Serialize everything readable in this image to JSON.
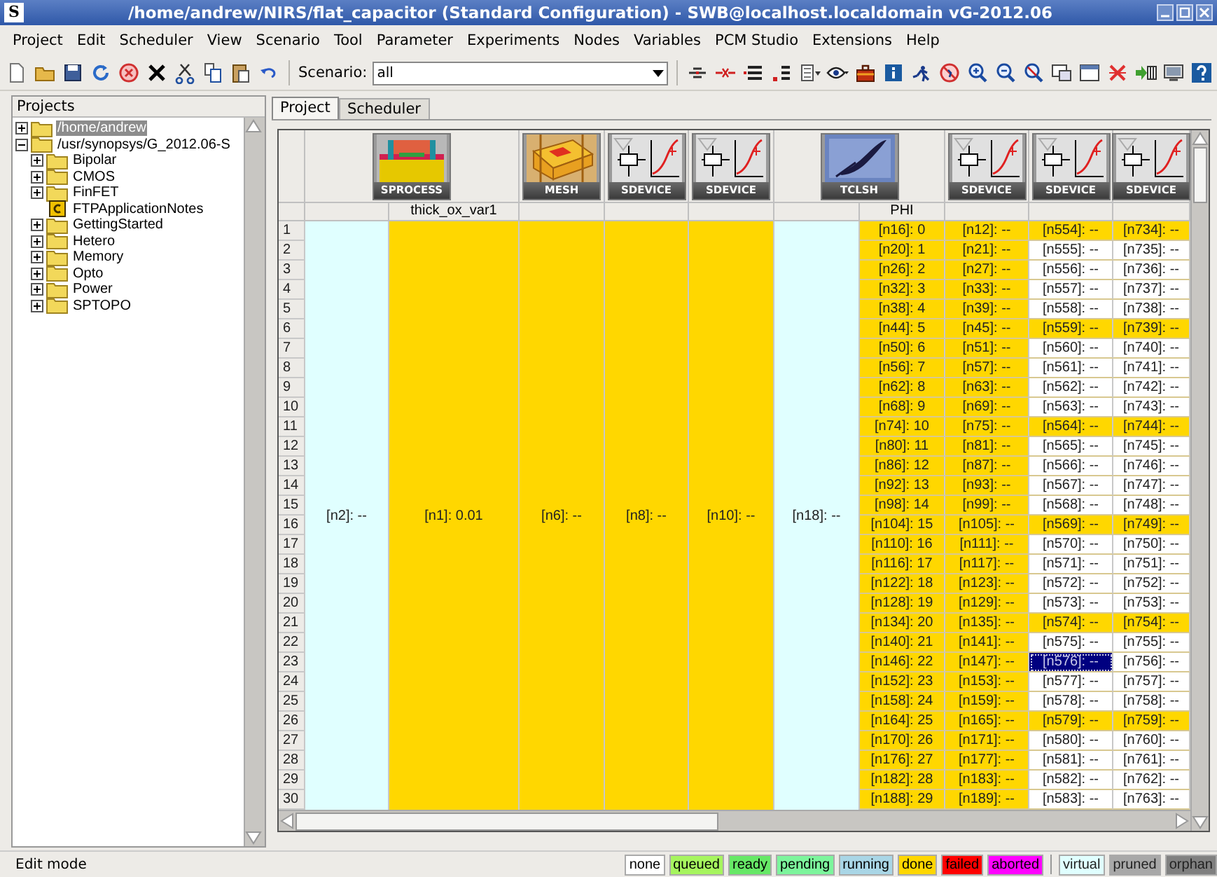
{
  "window": {
    "icon_letter": "S",
    "title": "/home/andrew/NIRS/flat_capacitor (Standard Configuration) - SWB@localhost.localdomain vG-2012.06"
  },
  "menu": [
    "Project",
    "Edit",
    "Scheduler",
    "View",
    "Scenario",
    "Tool",
    "Parameter",
    "Experiments",
    "Nodes",
    "Variables",
    "PCM Studio",
    "Extensions",
    "Help"
  ],
  "toolbar": {
    "scenario_label": "Scenario:",
    "scenario_value": "all"
  },
  "projects": {
    "title": "Projects",
    "items": [
      {
        "label": "/home/andrew",
        "kind": "folder",
        "expanded": false,
        "selected": true
      },
      {
        "label": "/usr/synopsys/G_2012.06-S",
        "kind": "folder",
        "expanded": true,
        "selected": false,
        "children": [
          {
            "label": "Bipolar",
            "kind": "folder",
            "expanded": false,
            "selected": false
          },
          {
            "label": "CMOS",
            "kind": "folder",
            "expanded": false,
            "selected": false
          },
          {
            "label": "FinFET",
            "kind": "folder",
            "expanded": false,
            "selected": false
          },
          {
            "label": "FTPApplicationNotes",
            "kind": "project",
            "selected": false
          },
          {
            "label": "GettingStarted",
            "kind": "folder",
            "expanded": false,
            "selected": false
          },
          {
            "label": "Hetero",
            "kind": "folder",
            "expanded": false,
            "selected": false
          },
          {
            "label": "Memory",
            "kind": "folder",
            "expanded": false,
            "selected": false
          },
          {
            "label": "Opto",
            "kind": "folder",
            "expanded": false,
            "selected": false
          },
          {
            "label": "Power",
            "kind": "folder",
            "expanded": false,
            "selected": false
          },
          {
            "label": "SPTOPO",
            "kind": "folder",
            "expanded": false,
            "selected": false
          }
        ]
      }
    ]
  },
  "tabs": [
    {
      "label": "Project",
      "selected": true
    },
    {
      "label": "Scheduler",
      "selected": false
    }
  ],
  "tools": [
    {
      "label": "SPROCESS",
      "kind": "sprocess",
      "parameters": [
        "thick_ox_var1"
      ]
    },
    {
      "label": "MESH",
      "kind": "mesh"
    },
    {
      "label": "SDEVICE",
      "kind": "sdevice"
    },
    {
      "label": "SDEVICE",
      "kind": "sdevice"
    },
    {
      "label": "TCLSH",
      "kind": "tclsh",
      "parameters": [
        "PHI"
      ]
    },
    {
      "label": "SDEVICE",
      "kind": "sdevice"
    },
    {
      "label": "SDEVICE",
      "kind": "sdevice"
    },
    {
      "label": "SDEVICE",
      "kind": "sdevice"
    }
  ],
  "merged_cells": [
    {
      "text": "[n2]: --",
      "color": "#e0ffff"
    },
    {
      "text": "[n1]: 0.01",
      "color": "#ffd700"
    },
    {
      "text": "[n6]: --",
      "color": "#ffd700"
    },
    {
      "text": "[n8]: --",
      "color": "#ffd700"
    },
    {
      "text": "[n10]: --",
      "color": "#ffd700"
    },
    {
      "text": "[n18]: --",
      "color": "#e0ffff"
    }
  ],
  "rows": [
    {
      "number": "1",
      "cells": [
        {
          "text": "[n16]: 0",
          "color": "#ffd700",
          "selected": false
        },
        {
          "text": "[n12]: --",
          "color": "#ffd700",
          "selected": false
        },
        {
          "text": "[n554]: --",
          "color": "#ffd700",
          "selected": false
        },
        {
          "text": "[n734]: --",
          "color": "#ffd700",
          "selected": false
        }
      ]
    },
    {
      "number": "2",
      "cells": [
        {
          "text": "[n20]: 1",
          "color": "#ffd700",
          "selected": false
        },
        {
          "text": "[n21]: --",
          "color": "#ffd700",
          "selected": false
        },
        {
          "text": "[n555]: --",
          "color": "#ffffff",
          "selected": false
        },
        {
          "text": "[n735]: --",
          "color": "#ffffff",
          "selected": false
        }
      ]
    },
    {
      "number": "3",
      "cells": [
        {
          "text": "[n26]: 2",
          "color": "#ffd700",
          "selected": false
        },
        {
          "text": "[n27]: --",
          "color": "#ffd700",
          "selected": false
        },
        {
          "text": "[n556]: --",
          "color": "#ffffff",
          "selected": false
        },
        {
          "text": "[n736]: --",
          "color": "#ffffff",
          "selected": false
        }
      ]
    },
    {
      "number": "4",
      "cells": [
        {
          "text": "[n32]: 3",
          "color": "#ffd700",
          "selected": false
        },
        {
          "text": "[n33]: --",
          "color": "#ffd700",
          "selected": false
        },
        {
          "text": "[n557]: --",
          "color": "#ffffff",
          "selected": false
        },
        {
          "text": "[n737]: --",
          "color": "#ffffff",
          "selected": false
        }
      ]
    },
    {
      "number": "5",
      "cells": [
        {
          "text": "[n38]: 4",
          "color": "#ffd700",
          "selected": false
        },
        {
          "text": "[n39]: --",
          "color": "#ffd700",
          "selected": false
        },
        {
          "text": "[n558]: --",
          "color": "#ffffff",
          "selected": false
        },
        {
          "text": "[n738]: --",
          "color": "#ffffff",
          "selected": false
        }
      ]
    },
    {
      "number": "6",
      "cells": [
        {
          "text": "[n44]: 5",
          "color": "#ffd700",
          "selected": false
        },
        {
          "text": "[n45]: --",
          "color": "#ffd700",
          "selected": false
        },
        {
          "text": "[n559]: --",
          "color": "#ffd700",
          "selected": false
        },
        {
          "text": "[n739]: --",
          "color": "#ffd700",
          "selected": false
        }
      ]
    },
    {
      "number": "7",
      "cells": [
        {
          "text": "[n50]: 6",
          "color": "#ffd700",
          "selected": false
        },
        {
          "text": "[n51]: --",
          "color": "#ffd700",
          "selected": false
        },
        {
          "text": "[n560]: --",
          "color": "#ffffff",
          "selected": false
        },
        {
          "text": "[n740]: --",
          "color": "#ffffff",
          "selected": false
        }
      ]
    },
    {
      "number": "8",
      "cells": [
        {
          "text": "[n56]: 7",
          "color": "#ffd700",
          "selected": false
        },
        {
          "text": "[n57]: --",
          "color": "#ffd700",
          "selected": false
        },
        {
          "text": "[n561]: --",
          "color": "#ffffff",
          "selected": false
        },
        {
          "text": "[n741]: --",
          "color": "#ffffff",
          "selected": false
        }
      ]
    },
    {
      "number": "9",
      "cells": [
        {
          "text": "[n62]: 8",
          "color": "#ffd700",
          "selected": false
        },
        {
          "text": "[n63]: --",
          "color": "#ffd700",
          "selected": false
        },
        {
          "text": "[n562]: --",
          "color": "#ffffff",
          "selected": false
        },
        {
          "text": "[n742]: --",
          "color": "#ffffff",
          "selected": false
        }
      ]
    },
    {
      "number": "10",
      "cells": [
        {
          "text": "[n68]: 9",
          "color": "#ffd700",
          "selected": false
        },
        {
          "text": "[n69]: --",
          "color": "#ffd700",
          "selected": false
        },
        {
          "text": "[n563]: --",
          "color": "#ffffff",
          "selected": false
        },
        {
          "text": "[n743]: --",
          "color": "#ffffff",
          "selected": false
        }
      ]
    },
    {
      "number": "11",
      "cells": [
        {
          "text": "[n74]: 10",
          "color": "#ffd700",
          "selected": false
        },
        {
          "text": "[n75]: --",
          "color": "#ffd700",
          "selected": false
        },
        {
          "text": "[n564]: --",
          "color": "#ffd700",
          "selected": false
        },
        {
          "text": "[n744]: --",
          "color": "#ffd700",
          "selected": false
        }
      ]
    },
    {
      "number": "12",
      "cells": [
        {
          "text": "[n80]: 11",
          "color": "#ffd700",
          "selected": false
        },
        {
          "text": "[n81]: --",
          "color": "#ffd700",
          "selected": false
        },
        {
          "text": "[n565]: --",
          "color": "#ffffff",
          "selected": false
        },
        {
          "text": "[n745]: --",
          "color": "#ffffff",
          "selected": false
        }
      ]
    },
    {
      "number": "13",
      "cells": [
        {
          "text": "[n86]: 12",
          "color": "#ffd700",
          "selected": false
        },
        {
          "text": "[n87]: --",
          "color": "#ffd700",
          "selected": false
        },
        {
          "text": "[n566]: --",
          "color": "#ffffff",
          "selected": false
        },
        {
          "text": "[n746]: --",
          "color": "#ffffff",
          "selected": false
        }
      ]
    },
    {
      "number": "14",
      "cells": [
        {
          "text": "[n92]: 13",
          "color": "#ffd700",
          "selected": false
        },
        {
          "text": "[n93]: --",
          "color": "#ffd700",
          "selected": false
        },
        {
          "text": "[n567]: --",
          "color": "#ffffff",
          "selected": false
        },
        {
          "text": "[n747]: --",
          "color": "#ffffff",
          "selected": false
        }
      ]
    },
    {
      "number": "15",
      "cells": [
        {
          "text": "[n98]: 14",
          "color": "#ffd700",
          "selected": false
        },
        {
          "text": "[n99]: --",
          "color": "#ffd700",
          "selected": false
        },
        {
          "text": "[n568]: --",
          "color": "#ffffff",
          "selected": false
        },
        {
          "text": "[n748]: --",
          "color": "#ffffff",
          "selected": false
        }
      ]
    },
    {
      "number": "16",
      "cells": [
        {
          "text": "[n104]: 15",
          "color": "#ffd700",
          "selected": false
        },
        {
          "text": "[n105]: --",
          "color": "#ffd700",
          "selected": false
        },
        {
          "text": "[n569]: --",
          "color": "#ffd700",
          "selected": false
        },
        {
          "text": "[n749]: --",
          "color": "#ffd700",
          "selected": false
        }
      ]
    },
    {
      "number": "17",
      "cells": [
        {
          "text": "[n110]: 16",
          "color": "#ffd700",
          "selected": false
        },
        {
          "text": "[n111]: --",
          "color": "#ffd700",
          "selected": false
        },
        {
          "text": "[n570]: --",
          "color": "#ffffff",
          "selected": false
        },
        {
          "text": "[n750]: --",
          "color": "#ffffff",
          "selected": false
        }
      ]
    },
    {
      "number": "18",
      "cells": [
        {
          "text": "[n116]: 17",
          "color": "#ffd700",
          "selected": false
        },
        {
          "text": "[n117]: --",
          "color": "#ffd700",
          "selected": false
        },
        {
          "text": "[n571]: --",
          "color": "#ffffff",
          "selected": false
        },
        {
          "text": "[n751]: --",
          "color": "#ffffff",
          "selected": false
        }
      ]
    },
    {
      "number": "19",
      "cells": [
        {
          "text": "[n122]: 18",
          "color": "#ffd700",
          "selected": false
        },
        {
          "text": "[n123]: --",
          "color": "#ffd700",
          "selected": false
        },
        {
          "text": "[n572]: --",
          "color": "#ffffff",
          "selected": false
        },
        {
          "text": "[n752]: --",
          "color": "#ffffff",
          "selected": false
        }
      ]
    },
    {
      "number": "20",
      "cells": [
        {
          "text": "[n128]: 19",
          "color": "#ffd700",
          "selected": false
        },
        {
          "text": "[n129]: --",
          "color": "#ffd700",
          "selected": false
        },
        {
          "text": "[n573]: --",
          "color": "#ffffff",
          "selected": false
        },
        {
          "text": "[n753]: --",
          "color": "#ffffff",
          "selected": false
        }
      ]
    },
    {
      "number": "21",
      "cells": [
        {
          "text": "[n134]: 20",
          "color": "#ffd700",
          "selected": false
        },
        {
          "text": "[n135]: --",
          "color": "#ffd700",
          "selected": false
        },
        {
          "text": "[n574]: --",
          "color": "#ffd700",
          "selected": false
        },
        {
          "text": "[n754]: --",
          "color": "#ffd700",
          "selected": false
        }
      ]
    },
    {
      "number": "22",
      "cells": [
        {
          "text": "[n140]: 21",
          "color": "#ffd700",
          "selected": false
        },
        {
          "text": "[n141]: --",
          "color": "#ffd700",
          "selected": false
        },
        {
          "text": "[n575]: --",
          "color": "#ffffff",
          "selected": false
        },
        {
          "text": "[n755]: --",
          "color": "#ffffff",
          "selected": false
        }
      ]
    },
    {
      "number": "23",
      "cells": [
        {
          "text": "[n146]: 22",
          "color": "#ffd700",
          "selected": false
        },
        {
          "text": "[n147]: --",
          "color": "#ffd700",
          "selected": false
        },
        {
          "text": "[n576]: --",
          "color": "#000080",
          "selected": true
        },
        {
          "text": "[n756]: --",
          "color": "#ffffff",
          "selected": false
        }
      ]
    },
    {
      "number": "24",
      "cells": [
        {
          "text": "[n152]: 23",
          "color": "#ffd700",
          "selected": false
        },
        {
          "text": "[n153]: --",
          "color": "#ffd700",
          "selected": false
        },
        {
          "text": "[n577]: --",
          "color": "#ffffff",
          "selected": false
        },
        {
          "text": "[n757]: --",
          "color": "#ffffff",
          "selected": false
        }
      ]
    },
    {
      "number": "25",
      "cells": [
        {
          "text": "[n158]: 24",
          "color": "#ffd700",
          "selected": false
        },
        {
          "text": "[n159]: --",
          "color": "#ffd700",
          "selected": false
        },
        {
          "text": "[n578]: --",
          "color": "#ffffff",
          "selected": false
        },
        {
          "text": "[n758]: --",
          "color": "#ffffff",
          "selected": false
        }
      ]
    },
    {
      "number": "26",
      "cells": [
        {
          "text": "[n164]: 25",
          "color": "#ffd700",
          "selected": false
        },
        {
          "text": "[n165]: --",
          "color": "#ffd700",
          "selected": false
        },
        {
          "text": "[n579]: --",
          "color": "#ffd700",
          "selected": false
        },
        {
          "text": "[n759]: --",
          "color": "#ffd700",
          "selected": false
        }
      ]
    },
    {
      "number": "27",
      "cells": [
        {
          "text": "[n170]: 26",
          "color": "#ffd700",
          "selected": false
        },
        {
          "text": "[n171]: --",
          "color": "#ffd700",
          "selected": false
        },
        {
          "text": "[n580]: --",
          "color": "#ffffff",
          "selected": false
        },
        {
          "text": "[n760]: --",
          "color": "#ffffff",
          "selected": false
        }
      ]
    },
    {
      "number": "28",
      "cells": [
        {
          "text": "[n176]: 27",
          "color": "#ffd700",
          "selected": false
        },
        {
          "text": "[n177]: --",
          "color": "#ffd700",
          "selected": false
        },
        {
          "text": "[n581]: --",
          "color": "#ffffff",
          "selected": false
        },
        {
          "text": "[n761]: --",
          "color": "#ffffff",
          "selected": false
        }
      ]
    },
    {
      "number": "29",
      "cells": [
        {
          "text": "[n182]: 28",
          "color": "#ffd700",
          "selected": false
        },
        {
          "text": "[n183]: --",
          "color": "#ffd700",
          "selected": false
        },
        {
          "text": "[n582]: --",
          "color": "#ffffff",
          "selected": false
        },
        {
          "text": "[n762]: --",
          "color": "#ffffff",
          "selected": false
        }
      ]
    },
    {
      "number": "30",
      "cells": [
        {
          "text": "[n188]: 29",
          "color": "#ffd700",
          "selected": false
        },
        {
          "text": "[n189]: --",
          "color": "#ffd700",
          "selected": false
        },
        {
          "text": "[n583]: --",
          "color": "#ffffff",
          "selected": false
        },
        {
          "text": "[n763]: --",
          "color": "#ffffff",
          "selected": false
        }
      ]
    }
  ],
  "status_bar": {
    "text": "Edit mode"
  },
  "legend": [
    {
      "label": "none",
      "kind": "state",
      "color": "#ffffff"
    },
    {
      "label": "queued",
      "kind": "state",
      "color": "#a6f55e"
    },
    {
      "label": "ready",
      "kind": "state",
      "color": "#66e866"
    },
    {
      "label": "pending",
      "kind": "state",
      "color": "#7cf59c"
    },
    {
      "label": "running",
      "kind": "state",
      "color": "#a9d6e6"
    },
    {
      "label": "done",
      "kind": "state",
      "color": "#ffd700"
    },
    {
      "label": "failed",
      "kind": "state",
      "color": "#ff0000"
    },
    {
      "label": "aborted",
      "kind": "state",
      "color": "#ff00ff"
    },
    {
      "label": "virtual",
      "kind": "view",
      "color": "#e0ffff"
    },
    {
      "label": "pruned",
      "kind": "view",
      "color": "#a8a8a8"
    },
    {
      "label": "orphan",
      "kind": "view",
      "color": "#808080"
    }
  ]
}
